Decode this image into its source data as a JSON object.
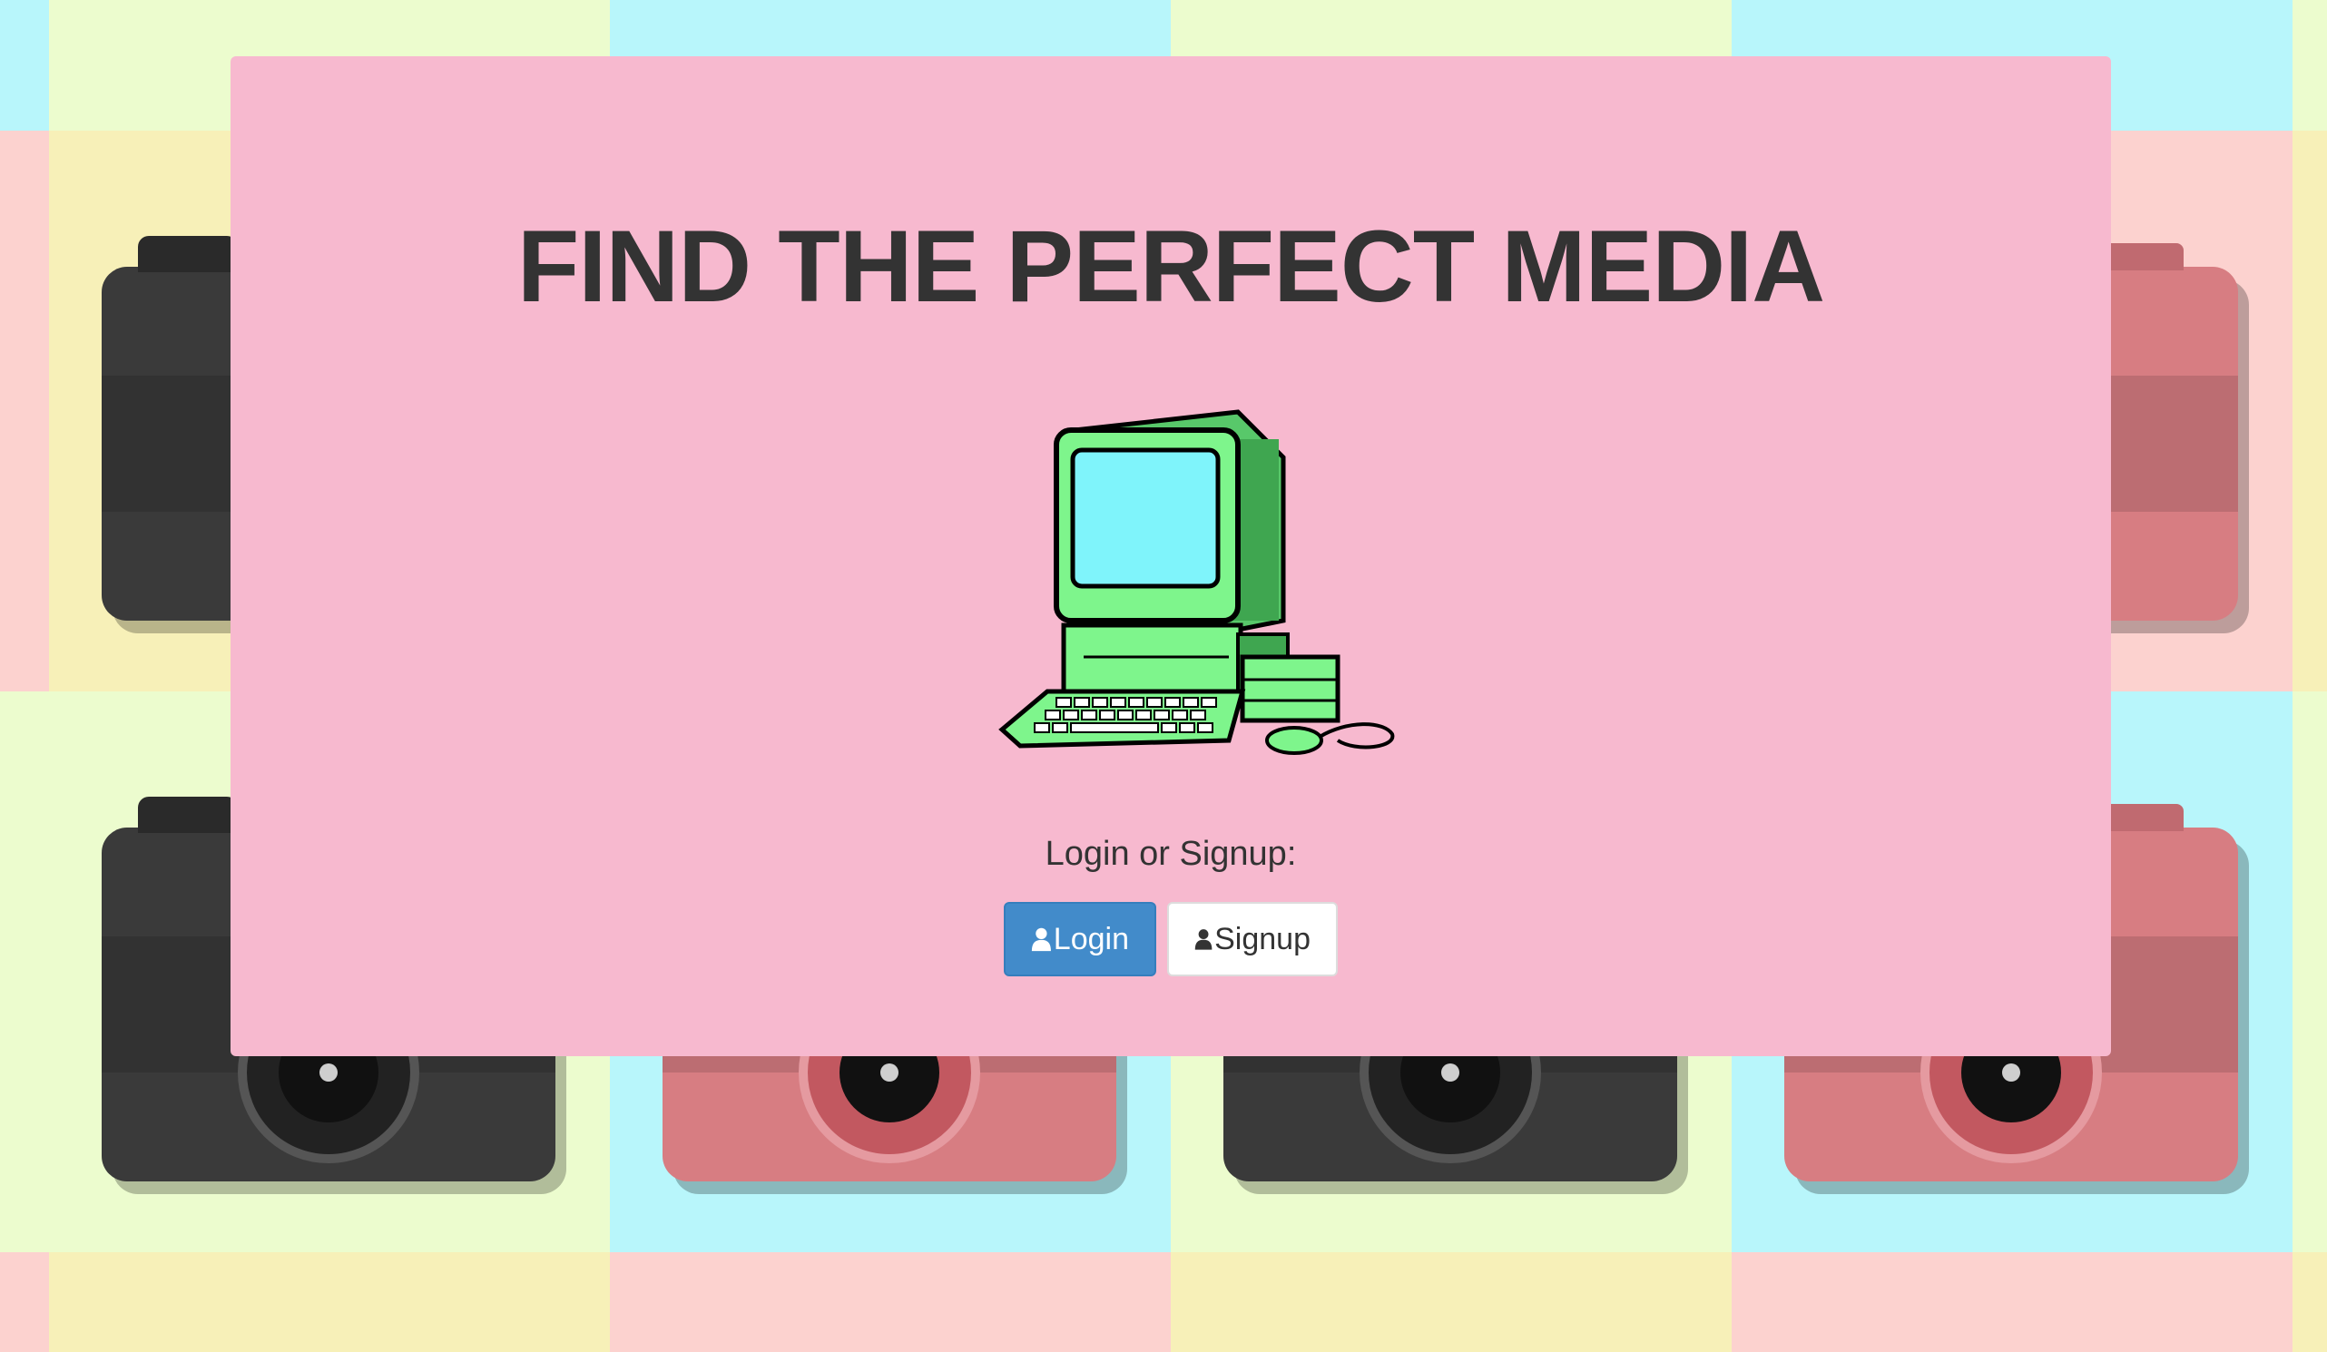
{
  "title": "FIND THE PERFECT MEDIA",
  "prompt": "Login or Signup:",
  "buttons": {
    "login": {
      "label": "Login",
      "icon": "user-icon"
    },
    "signup": {
      "label": "Signup",
      "icon": "user-icon"
    }
  },
  "colors": {
    "panel": "#f7b9cf",
    "login_button": "#428bca",
    "signup_button": "#ffffff",
    "text": "#333333",
    "computer_body": "#7ef58c",
    "computer_screen": "#7ff4fb"
  },
  "illustration": "pixel-art retro desktop computer with keyboard and mouse"
}
